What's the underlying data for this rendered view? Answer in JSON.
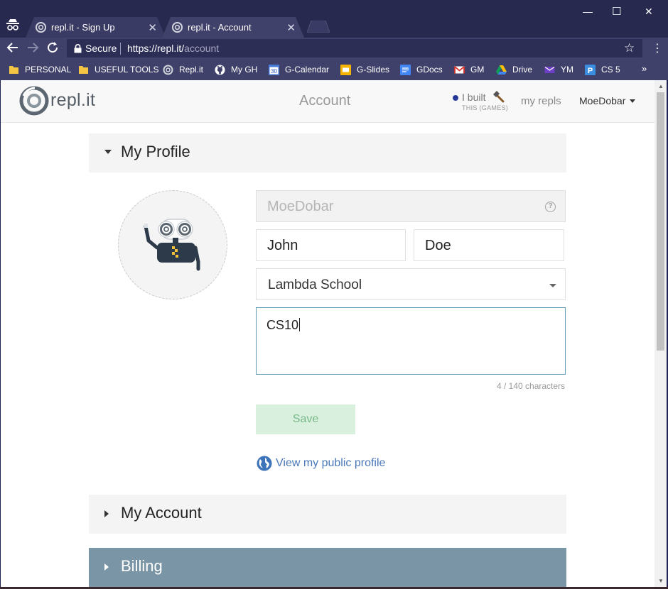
{
  "browser": {
    "tabs": [
      {
        "title": "repl.it - Sign Up",
        "close": "✕"
      },
      {
        "title": "repl.it - Account",
        "close": "✕"
      }
    ],
    "window_controls": {
      "minimize": "—",
      "maximize": "☐",
      "close": "✕"
    },
    "omnibox": {
      "secure_label": "Secure",
      "url_host": "https://repl.it/",
      "url_path": "account"
    },
    "bookmarks": [
      {
        "label": "PERSONAL",
        "icon": "folder-icon"
      },
      {
        "label": "USEFUL TOOLS",
        "icon": "folder-icon"
      },
      {
        "label": "Repl.it",
        "icon": "replit-icon"
      },
      {
        "label": "My GH",
        "icon": "github-icon"
      },
      {
        "label": "G-Calendar",
        "icon": "calendar-icon",
        "badge": "30"
      },
      {
        "label": "G-Slides",
        "icon": "slides-icon"
      },
      {
        "label": "GDocs",
        "icon": "docs-icon"
      },
      {
        "label": "GM",
        "icon": "gmail-icon"
      },
      {
        "label": "Drive",
        "icon": "drive-icon"
      },
      {
        "label": "YM",
        "icon": "mail-icon"
      },
      {
        "label": "CS 5",
        "icon": "p-icon"
      }
    ],
    "bookmarks_overflow": "»"
  },
  "app": {
    "logo_text": "repl.it",
    "page_title": "Account",
    "ibuilt": {
      "label": "I built",
      "sub": "THIS (GAMES)"
    },
    "my_repls": "my repls",
    "username": "MoeDobar"
  },
  "profile": {
    "section_title": "My Profile",
    "username_value": "MoeDobar",
    "first_name": "John",
    "last_name": "Doe",
    "school": "Lambda School",
    "bio": "CS10",
    "char_count": "4 / 140 characters",
    "save_label": "Save",
    "public_profile_link": "View my public profile"
  },
  "sections": {
    "account_title": "My Account",
    "billing_title": "Billing"
  },
  "colors": {
    "billing_bg": "#7a96a6",
    "save_bg": "#daf0de",
    "link": "#4a78b8",
    "accent_dot": "#273a99"
  }
}
